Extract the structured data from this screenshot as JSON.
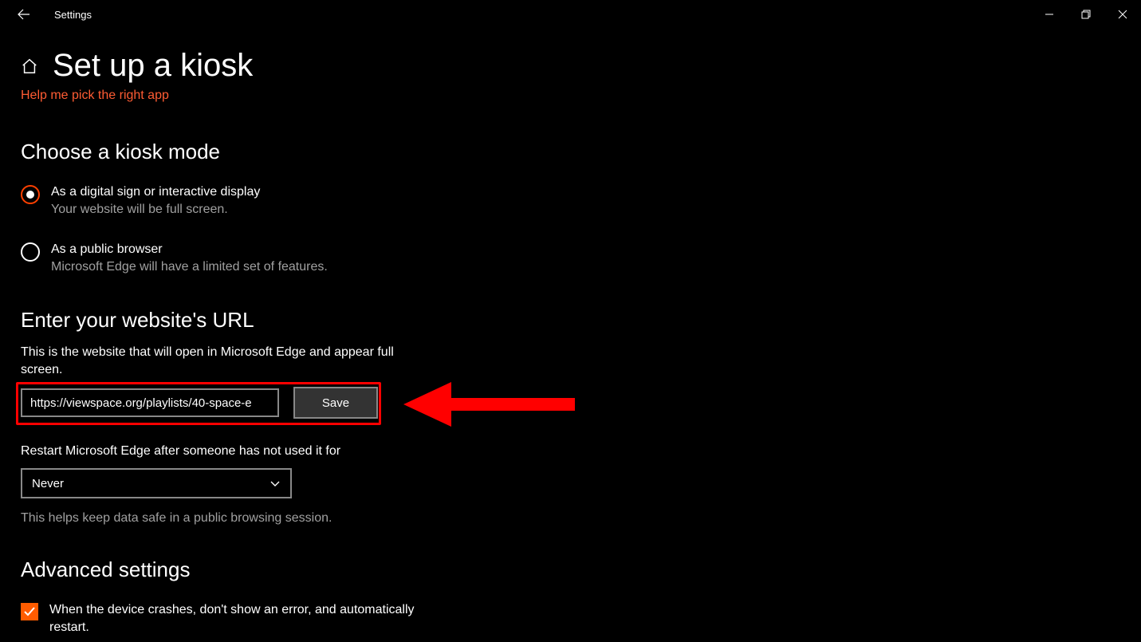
{
  "window": {
    "app_title": "Settings"
  },
  "page": {
    "title": "Set up a kiosk",
    "help_link": "Help me pick the right app"
  },
  "kiosk_mode": {
    "heading": "Choose a kiosk mode",
    "option1": {
      "label": "As a digital sign or interactive display",
      "sub": "Your website will be full screen."
    },
    "option2": {
      "label": "As a public browser",
      "sub": "Microsoft Edge will have a limited set of features."
    }
  },
  "url_section": {
    "heading": "Enter your website's URL",
    "description": "This is the website that will open in Microsoft Edge and appear full screen.",
    "value": "https://viewspace.org/playlists/40-space-e",
    "save_label": "Save"
  },
  "restart_section": {
    "label": "Restart Microsoft Edge after someone has not used it for",
    "selected": "Never",
    "hint": "This helps keep data safe in a public browsing session."
  },
  "advanced": {
    "heading": "Advanced settings",
    "check1": "When the device crashes, don't show an error, and automatically restart."
  }
}
